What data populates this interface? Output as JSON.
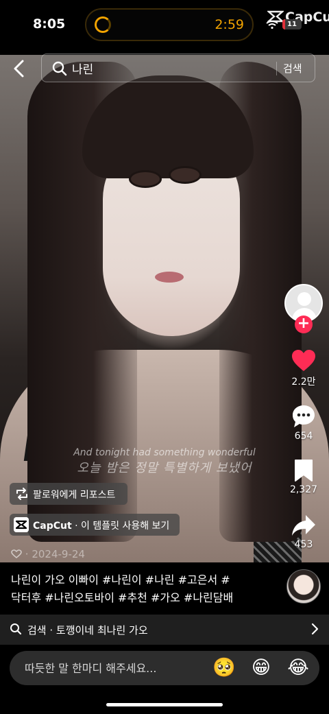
{
  "status_bar": {
    "time": "8:05",
    "timer": "2:59",
    "app_label": "CapCu",
    "battery": "11"
  },
  "search": {
    "query": "나린",
    "button_label": "검색"
  },
  "video": {
    "subtitle_en": "And tonight had something wonderful",
    "subtitle_ko": "오늘 밤은 정말 특별하게 보냈어",
    "repost_label": "팔로워에게 리포스트",
    "template_brand": "CapCut",
    "template_text": " · 이 템플릿 사용해 보기",
    "date": "· 2024-9-24"
  },
  "rail": {
    "likes": "2.2만",
    "comments": "654",
    "saves": "2,327",
    "shares": "453"
  },
  "description": {
    "line1": "나린이 가오 이빠이 #나린이 #나린 #고은서 #",
    "line2": "닥터후 #나린오토바이 #추천 #가오 #나린담배"
  },
  "related_search": {
    "text": "검색 · 토깽이네 최나린 가오"
  },
  "comment": {
    "placeholder": "따듯한 말 한마디 해주세요...",
    "emojis": [
      "🥺",
      "😁",
      "😂"
    ]
  },
  "colors": {
    "like": "#fe2c55",
    "timer": "#f2a300"
  }
}
